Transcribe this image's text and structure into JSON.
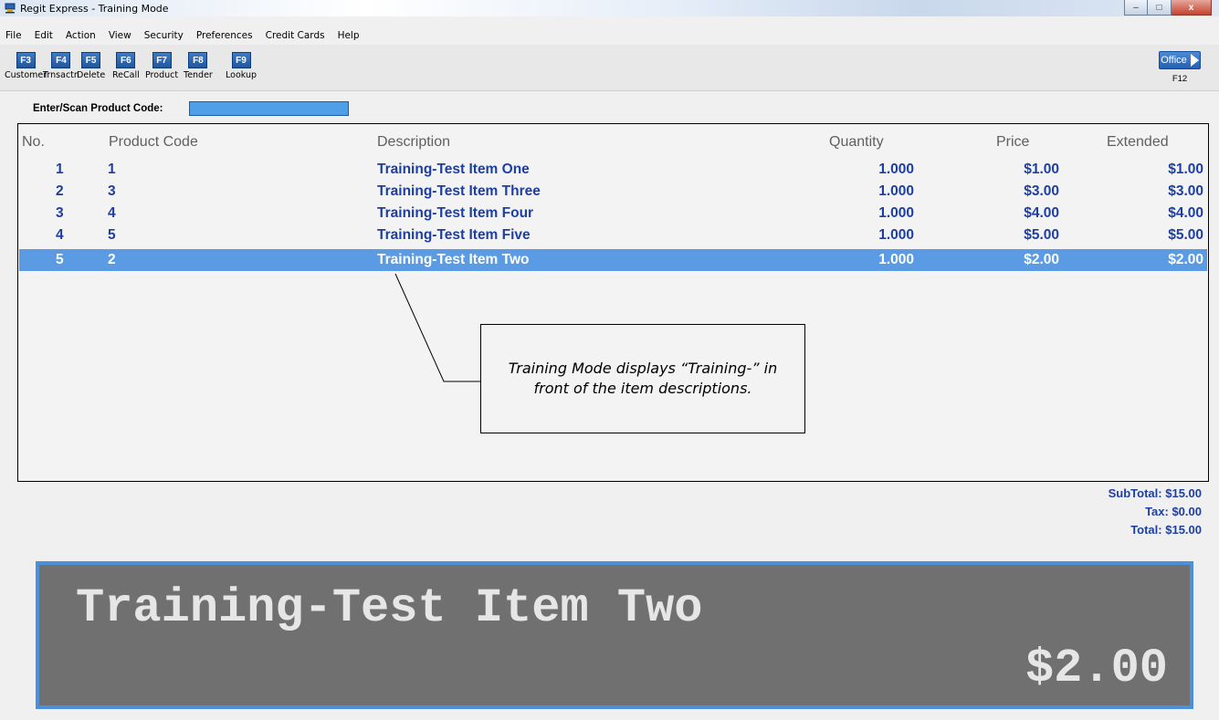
{
  "window": {
    "title": "Regit Express - Training Mode",
    "minimize_glyph": "–",
    "maximize_glyph": "□",
    "close_glyph": "x"
  },
  "menu": [
    "File",
    "Edit",
    "Action",
    "View",
    "Security",
    "Preferences",
    "Credit Cards",
    "Help"
  ],
  "toolbar": {
    "tools": [
      {
        "key": "F3",
        "label": "Customer"
      },
      {
        "key": "F4",
        "label": "Trnsactn"
      },
      {
        "key": "F5",
        "label": "Delete"
      },
      {
        "key": "F6",
        "label": "ReCall"
      },
      {
        "key": "F7",
        "label": "Product"
      },
      {
        "key": "F8",
        "label": "Tender"
      },
      {
        "key": "F9",
        "label": "Lookup"
      }
    ],
    "office_label": "Office",
    "office_key": "F12"
  },
  "scan": {
    "label": "Enter/Scan Product Code:",
    "value": ""
  },
  "grid": {
    "headers": {
      "no": "No.",
      "code": "Product Code",
      "description": "Description",
      "quantity": "Quantity",
      "price": "Price",
      "extended": "Extended"
    },
    "rows": [
      {
        "no": "1",
        "code": "1",
        "description": "Training-Test Item One",
        "quantity": "1.000",
        "price": "$1.00",
        "extended": "$1.00"
      },
      {
        "no": "2",
        "code": "3",
        "description": "Training-Test Item Three",
        "quantity": "1.000",
        "price": "$3.00",
        "extended": "$3.00"
      },
      {
        "no": "3",
        "code": "4",
        "description": "Training-Test Item Four",
        "quantity": "1.000",
        "price": "$4.00",
        "extended": "$4.00"
      },
      {
        "no": "4",
        "code": "5",
        "description": "Training-Test Item Five",
        "quantity": "1.000",
        "price": "$5.00",
        "extended": "$5.00"
      },
      {
        "no": "5",
        "code": "2",
        "description": "Training-Test Item Two",
        "quantity": "1.000",
        "price": "$2.00",
        "extended": "$2.00"
      }
    ],
    "selected_row": 5
  },
  "callout": {
    "text": "Training Mode displays “Training-” in front of the item descriptions."
  },
  "totals": {
    "subtotal_label": "SubTotal:",
    "subtotal": "$15.00",
    "tax_label": "Tax:",
    "tax": "$0.00",
    "total_label": "Total:",
    "total": "$15.00"
  },
  "pole_display": {
    "description": "Training-Test Item Two",
    "price": "$2.00"
  },
  "colors": {
    "accent": "#4b90d9",
    "row_text": "#1e3fa2",
    "selected_row": "#5a9be4",
    "pole_background": "#707070"
  }
}
